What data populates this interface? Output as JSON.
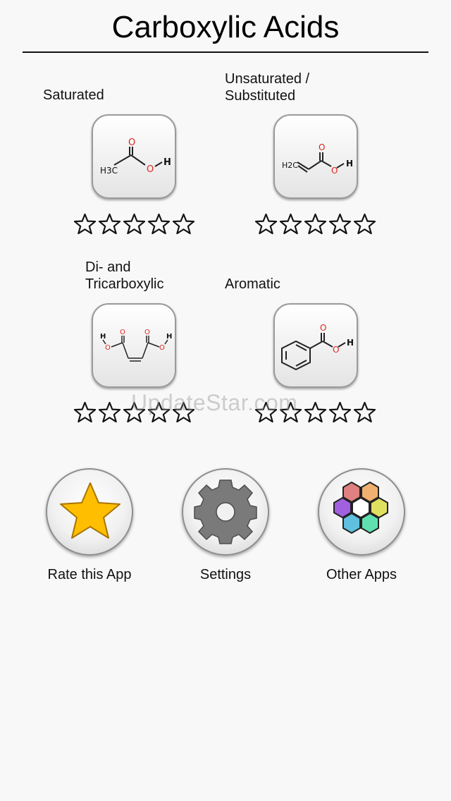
{
  "header": {
    "title": "Carboxylic Acids"
  },
  "categories": [
    {
      "label": "Saturated",
      "rating": 0,
      "max_rating": 5,
      "icon": "acetic-acid-structure-icon",
      "structure_text": {
        "ch3": "H3C",
        "o_top": "O",
        "oh_o": "O",
        "oh_h": "H"
      }
    },
    {
      "label": "Unsaturated / Substituted",
      "rating": 0,
      "max_rating": 5,
      "icon": "acrylic-acid-structure-icon",
      "structure_text": {
        "ch2": "H2C",
        "o_top": "O",
        "oh_o": "O",
        "oh_h": "H"
      }
    },
    {
      "label": "Di- and Tricarboxylic",
      "rating": 0,
      "max_rating": 5,
      "icon": "maleic-acid-structure-icon",
      "structure_text": {
        "h_left": "H",
        "o_left": "O",
        "o_top_l": "O",
        "o_top_r": "O",
        "o_right": "O",
        "h_right": "H"
      }
    },
    {
      "label": "Aromatic",
      "rating": 0,
      "max_rating": 5,
      "icon": "benzoic-acid-structure-icon",
      "structure_text": {
        "o_top": "O",
        "oh_o": "O",
        "oh_h": "H"
      }
    }
  ],
  "actions": [
    {
      "label": "Rate this App",
      "icon": "star-icon"
    },
    {
      "label": "Settings",
      "icon": "gear-icon"
    },
    {
      "label": "Other Apps",
      "icon": "colored-hexagons-icon"
    }
  ],
  "watermark": "UpdateStar.com",
  "colors": {
    "oxygen": "#e0241b",
    "bond": "#222222",
    "star_fill": "#ffbf00",
    "gear": "#7a7a7a"
  }
}
